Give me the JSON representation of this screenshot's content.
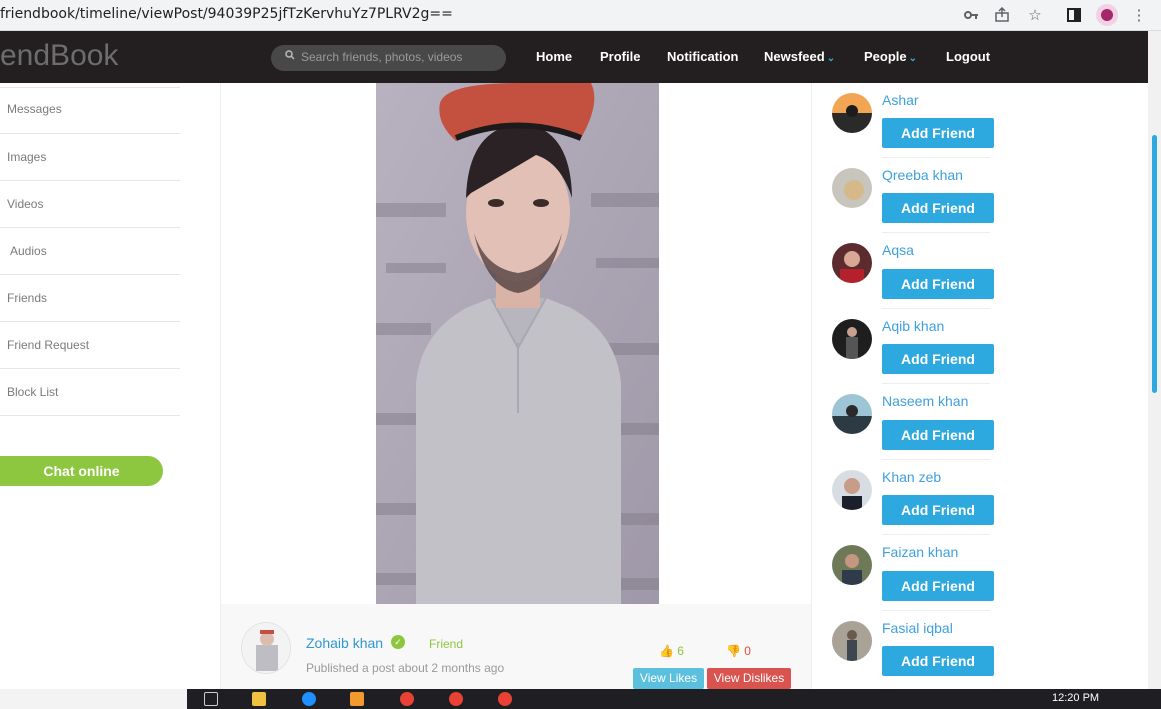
{
  "browser": {
    "url": "friendbook/timeline/viewPost/94039P25jfTzKervhuYz7PLRV2g=="
  },
  "navbar": {
    "logo": "endBook",
    "search_placeholder": "Search friends, photos, videos",
    "links": [
      "Home",
      "Profile",
      "Notification",
      "Newsfeed",
      "People",
      "Logout"
    ]
  },
  "sidebar": {
    "items": [
      "Messages",
      "Images",
      "Videos",
      "Audios",
      "Friends",
      "Friend Request",
      "Block List"
    ],
    "chat_button": "Chat online"
  },
  "post": {
    "author": "Zohaib khan",
    "relation": "Friend",
    "published": "Published a post about 2 months ago",
    "likes": "6",
    "dislikes": "0",
    "view_likes": "View Likes",
    "view_dislikes": "View Dislikes"
  },
  "suggestions": [
    {
      "name": "Ashar",
      "button": "Add Friend"
    },
    {
      "name": "Qreeba khan",
      "button": "Add Friend"
    },
    {
      "name": "Aqsa",
      "button": "Add Friend"
    },
    {
      "name": "Aqib khan",
      "button": "Add Friend"
    },
    {
      "name": "Naseem khan",
      "button": "Add Friend"
    },
    {
      "name": "Khan zeb",
      "button": "Add Friend"
    },
    {
      "name": "Faizan khan",
      "button": "Add Friend"
    },
    {
      "name": "Fasial iqbal",
      "button": "Add Friend"
    }
  ],
  "taskbar": {
    "clock": "12:20 PM"
  },
  "colors": {
    "accent": "#2ea9e0",
    "green": "#8dc63f",
    "navbar": "#231f20",
    "danger": "#d9534f"
  }
}
